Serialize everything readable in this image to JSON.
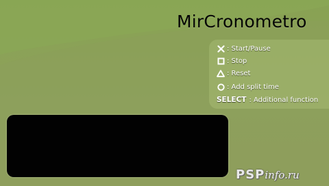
{
  "app": {
    "title": "MirCronometro"
  },
  "controls": [
    {
      "icon": "cross-button-icon",
      "label": ": Start/Pause"
    },
    {
      "icon": "square-button-icon",
      "label": ": Stop"
    },
    {
      "icon": "triangle-button-icon",
      "label": ": Reset"
    },
    {
      "icon": "circle-button-icon",
      "label": ": Add split time"
    }
  ],
  "select_control": {
    "key": "SELECT",
    "label": ": Additional function"
  },
  "watermark": {
    "brand": "PSP",
    "suffix": "info.ru"
  },
  "colors": {
    "background": "#89a055",
    "display": "#020202",
    "text": "#ffffff"
  }
}
